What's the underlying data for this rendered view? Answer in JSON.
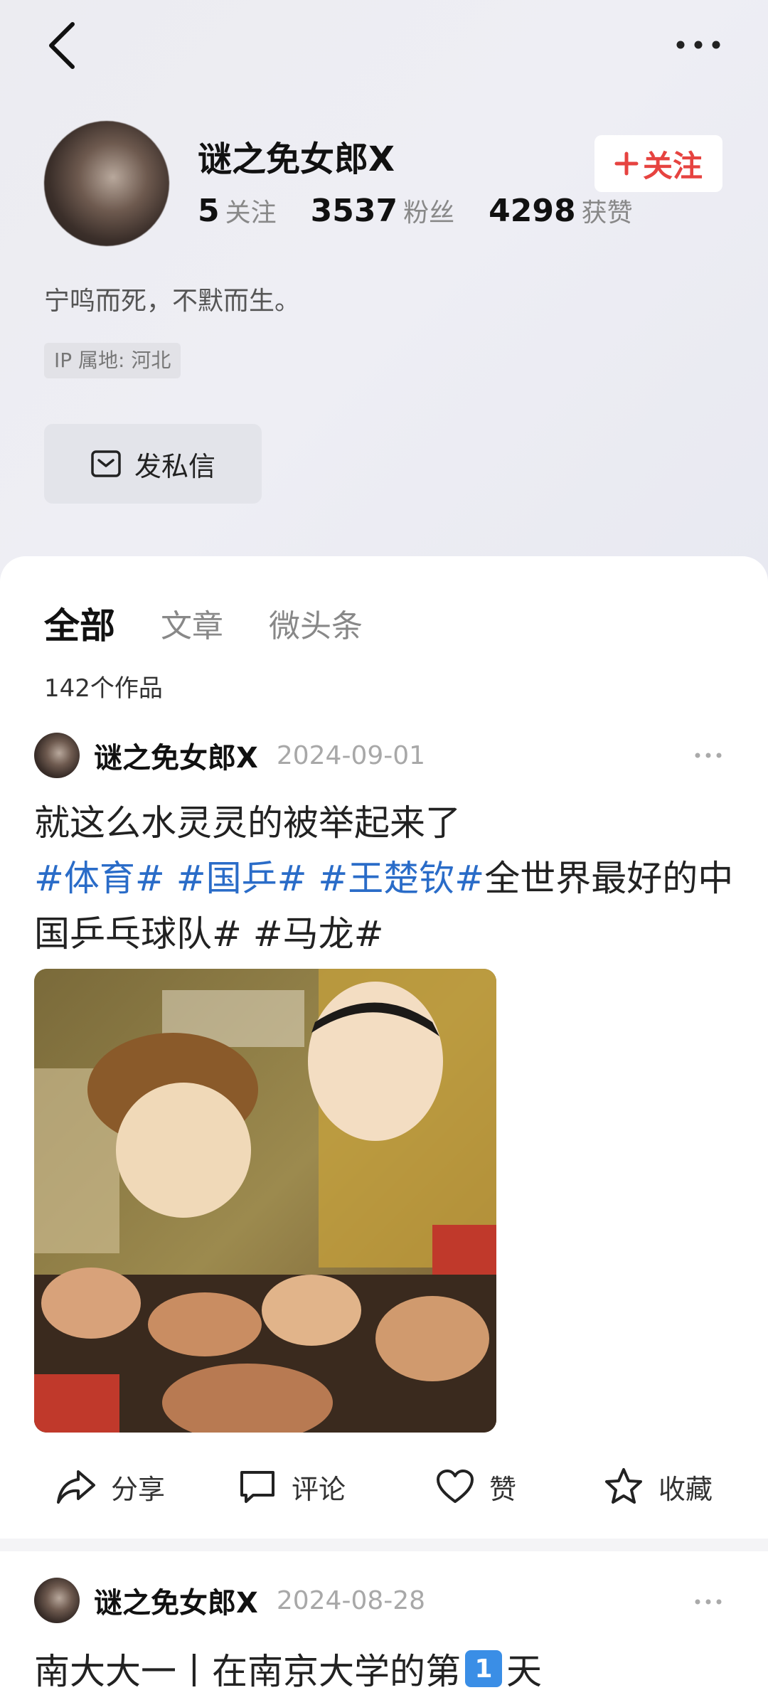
{
  "profile": {
    "name": "谜之免女郎X",
    "follow_label": "关注",
    "stats": [
      {
        "value": "5",
        "label": "关注"
      },
      {
        "value": "3537",
        "label": "粉丝"
      },
      {
        "value": "4298",
        "label": "获赞"
      }
    ],
    "bio": "宁鸣而死，不默而生。",
    "ip_location": "IP 属地: 河北",
    "message_label": "发私信"
  },
  "tabs": [
    {
      "label": "全部",
      "active": true
    },
    {
      "label": "文章",
      "active": false
    },
    {
      "label": "微头条",
      "active": false
    }
  ],
  "works_count": "142个作品",
  "posts": [
    {
      "author": "谜之免女郎X",
      "date": "2024-09-01",
      "text_line1": "就这么水灵灵的被举起来了",
      "tags": [
        "#体育#",
        "#国乒#",
        "#王楚钦#"
      ],
      "text_tail": "全世界最好的中国乒乓球队# #马龙#",
      "actions": {
        "share": "分享",
        "comment": "评论",
        "like": "赞",
        "collect": "收藏"
      }
    },
    {
      "author": "谜之免女郎X",
      "date": "2024-08-28",
      "text_before": "南大大一丨在南京大学的第",
      "badge": "1",
      "text_after": "天"
    }
  ],
  "colors": {
    "accent_red": "#e64340",
    "tag_blue": "#2a6cc8"
  },
  "icons": [
    "back-icon",
    "more-icon",
    "mail-icon",
    "share-icon",
    "comment-icon",
    "heart-icon",
    "star-icon"
  ]
}
